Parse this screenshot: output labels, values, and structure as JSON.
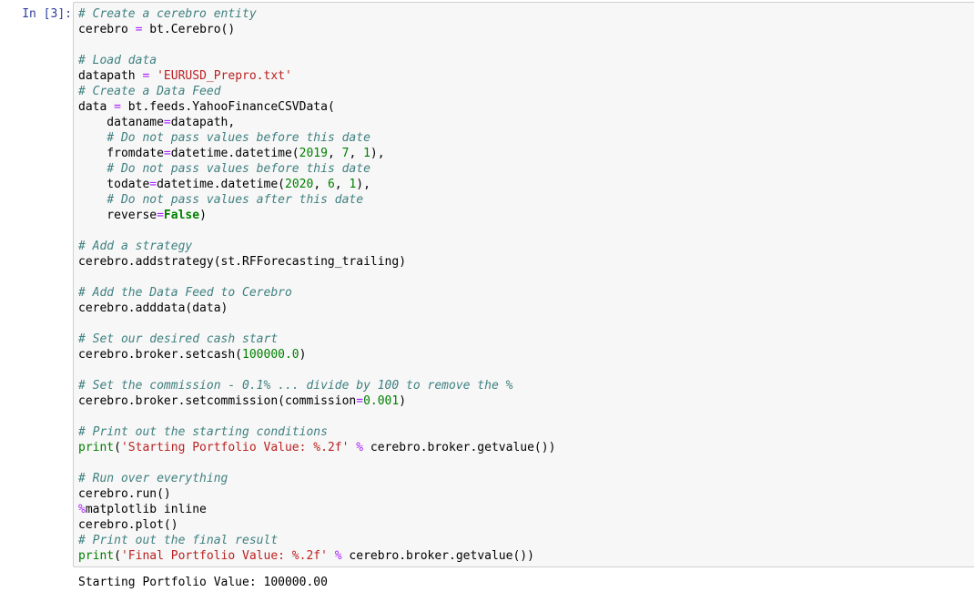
{
  "cell": {
    "prompt": "In [3]:",
    "colors": {
      "prompt": "#303f9f",
      "comment": "#408080",
      "string": "#ba2121",
      "number": "#008000",
      "keyword": "#008000",
      "operator": "#aa22ff",
      "background": "#f7f7f7",
      "border": "#cfcfcf"
    },
    "code_lines": [
      [
        {
          "t": "comment",
          "v": "# Create a cerebro entity"
        }
      ],
      [
        {
          "t": "plain",
          "v": "cerebro "
        },
        {
          "t": "op",
          "v": "="
        },
        {
          "t": "plain",
          "v": " bt.Cerebro()"
        }
      ],
      [],
      [
        {
          "t": "comment",
          "v": "# Load data"
        }
      ],
      [
        {
          "t": "plain",
          "v": "datapath "
        },
        {
          "t": "op",
          "v": "="
        },
        {
          "t": "plain",
          "v": " "
        },
        {
          "t": "str",
          "v": "'EURUSD_Prepro.txt'"
        }
      ],
      [
        {
          "t": "comment",
          "v": "# Create a Data Feed"
        }
      ],
      [
        {
          "t": "plain",
          "v": "data "
        },
        {
          "t": "op",
          "v": "="
        },
        {
          "t": "plain",
          "v": " bt.feeds.YahooFinanceCSVData("
        }
      ],
      [
        {
          "t": "plain",
          "v": "    dataname"
        },
        {
          "t": "op",
          "v": "="
        },
        {
          "t": "plain",
          "v": "datapath,"
        }
      ],
      [
        {
          "t": "plain",
          "v": "    "
        },
        {
          "t": "comment",
          "v": "# Do not pass values before this date"
        }
      ],
      [
        {
          "t": "plain",
          "v": "    fromdate"
        },
        {
          "t": "op",
          "v": "="
        },
        {
          "t": "plain",
          "v": "datetime.datetime("
        },
        {
          "t": "num",
          "v": "2019"
        },
        {
          "t": "plain",
          "v": ", "
        },
        {
          "t": "num",
          "v": "7"
        },
        {
          "t": "plain",
          "v": ", "
        },
        {
          "t": "num",
          "v": "1"
        },
        {
          "t": "plain",
          "v": "),"
        }
      ],
      [
        {
          "t": "plain",
          "v": "    "
        },
        {
          "t": "comment",
          "v": "# Do not pass values before this date"
        }
      ],
      [
        {
          "t": "plain",
          "v": "    todate"
        },
        {
          "t": "op",
          "v": "="
        },
        {
          "t": "plain",
          "v": "datetime.datetime("
        },
        {
          "t": "num",
          "v": "2020"
        },
        {
          "t": "plain",
          "v": ", "
        },
        {
          "t": "num",
          "v": "6"
        },
        {
          "t": "plain",
          "v": ", "
        },
        {
          "t": "num",
          "v": "1"
        },
        {
          "t": "plain",
          "v": "),"
        }
      ],
      [
        {
          "t": "plain",
          "v": "    "
        },
        {
          "t": "comment",
          "v": "# Do not pass values after this date"
        }
      ],
      [
        {
          "t": "plain",
          "v": "    reverse"
        },
        {
          "t": "op",
          "v": "="
        },
        {
          "t": "kw",
          "v": "False"
        },
        {
          "t": "plain",
          "v": ")"
        }
      ],
      [],
      [
        {
          "t": "comment",
          "v": "# Add a strategy"
        }
      ],
      [
        {
          "t": "plain",
          "v": "cerebro.addstrategy(st.RFForecasting_trailing)"
        }
      ],
      [],
      [
        {
          "t": "comment",
          "v": "# Add the Data Feed to Cerebro"
        }
      ],
      [
        {
          "t": "plain",
          "v": "cerebro.adddata(data)"
        }
      ],
      [],
      [
        {
          "t": "comment",
          "v": "# Set our desired cash start"
        }
      ],
      [
        {
          "t": "plain",
          "v": "cerebro.broker.setcash("
        },
        {
          "t": "num",
          "v": "100000.0"
        },
        {
          "t": "plain",
          "v": ")"
        }
      ],
      [],
      [
        {
          "t": "comment",
          "v": "# Set the commission - 0.1% ... divide by 100 to remove the %"
        }
      ],
      [
        {
          "t": "plain",
          "v": "cerebro.broker.setcommission(commission"
        },
        {
          "t": "op",
          "v": "="
        },
        {
          "t": "num",
          "v": "0.001"
        },
        {
          "t": "plain",
          "v": ")"
        }
      ],
      [],
      [
        {
          "t": "comment",
          "v": "# Print out the starting conditions"
        }
      ],
      [
        {
          "t": "kw-plain",
          "v": "print"
        },
        {
          "t": "plain",
          "v": "("
        },
        {
          "t": "str",
          "v": "'Starting Portfolio Value: %.2f'"
        },
        {
          "t": "plain",
          "v": " "
        },
        {
          "t": "op",
          "v": "%"
        },
        {
          "t": "plain",
          "v": " cerebro.broker.getvalue())"
        }
      ],
      [],
      [
        {
          "t": "comment",
          "v": "# Run over everything"
        }
      ],
      [
        {
          "t": "plain",
          "v": "cerebro.run()"
        }
      ],
      [
        {
          "t": "magic",
          "v": "%"
        },
        {
          "t": "plain",
          "v": "matplotlib inline"
        }
      ],
      [
        {
          "t": "plain",
          "v": "cerebro.plot()"
        }
      ],
      [
        {
          "t": "comment",
          "v": "# Print out the final result"
        }
      ],
      [
        {
          "t": "kw-plain",
          "v": "print"
        },
        {
          "t": "plain",
          "v": "("
        },
        {
          "t": "str",
          "v": "'Final Portfolio Value: %.2f'"
        },
        {
          "t": "plain",
          "v": " "
        },
        {
          "t": "op",
          "v": "%"
        },
        {
          "t": "plain",
          "v": " cerebro.broker.getvalue())"
        }
      ]
    ],
    "output": "Starting Portfolio Value: 100000.00"
  }
}
